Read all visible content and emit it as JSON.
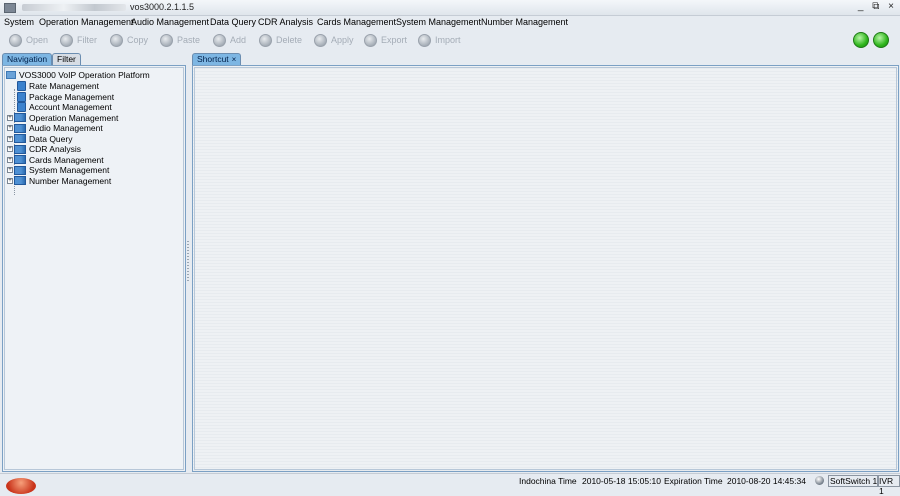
{
  "window": {
    "title": "vos3000.2.1.1.5",
    "controls": {
      "minimize": "_",
      "restore": "⧉",
      "close": "×"
    }
  },
  "menubar": {
    "items": [
      "System",
      "Operation Management",
      "Audio Management",
      "Data Query",
      "CDR Analysis",
      "Cards Management",
      "System Management",
      "Number Management"
    ]
  },
  "toolbar": {
    "buttons": [
      {
        "label": "Open",
        "icon": "open-icon"
      },
      {
        "label": "Filter",
        "icon": "filter-icon"
      },
      {
        "label": "Copy",
        "icon": "copy-icon"
      },
      {
        "label": "Paste",
        "icon": "paste-icon"
      },
      {
        "label": "Add",
        "icon": "add-icon"
      },
      {
        "label": "Delete",
        "icon": "delete-icon"
      },
      {
        "label": "Apply",
        "icon": "apply-icon"
      },
      {
        "label": "Export",
        "icon": "export-icon"
      },
      {
        "label": "Import",
        "icon": "import-icon"
      }
    ],
    "status_colors": [
      "#2fb51d",
      "#2fb51d"
    ]
  },
  "left_panel": {
    "tabs": [
      "Navigation",
      "Filter"
    ],
    "tree": {
      "root": "VOS3000 VoIP Operation Platform",
      "leaves": [
        "Rate Management",
        "Package Management",
        "Account Management"
      ],
      "groups": [
        "Operation Management",
        "Audio Management",
        "Data Query",
        "CDR Analysis",
        "Cards Management",
        "System Management",
        "Number Management"
      ],
      "expand_symbol": "+"
    }
  },
  "right_panel": {
    "tab": "Shortcut",
    "tab_close": "×"
  },
  "statusbar": {
    "timezone": "Indochina Time",
    "current_time": "2010-05-18 15:05:10",
    "expiration_label": "Expiration Time",
    "expiration_time": "2010-08-20 14:45:34",
    "softswitch": "SoftSwitch 1",
    "ivr": "IVR 1"
  },
  "colors": {
    "accent_tab": "#7db6e3",
    "panel_border": "#7ba0c4",
    "background": "#e6ebf1"
  }
}
